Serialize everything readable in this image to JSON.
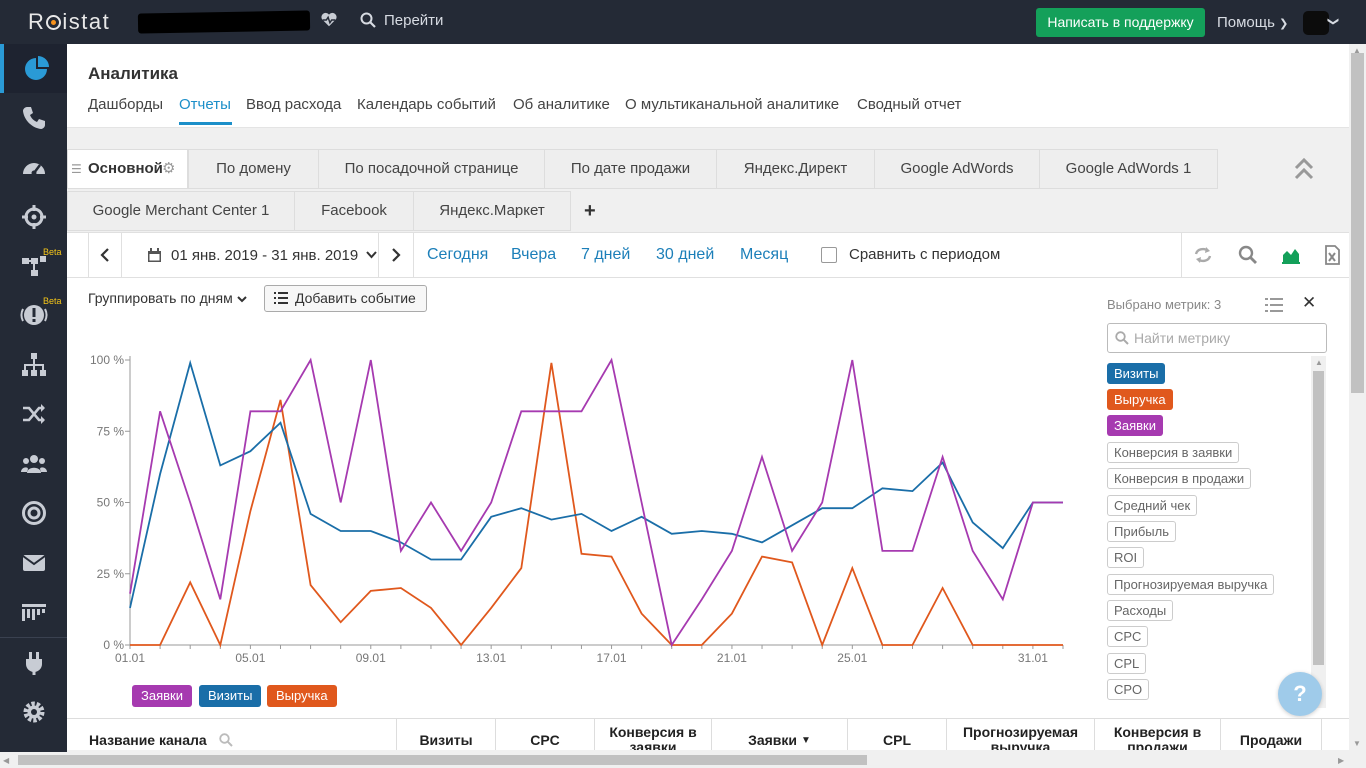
{
  "app": {
    "logo": "Roistat",
    "go_label": "Перейти",
    "support_button": "Написать в поддержку",
    "help_menu": "Помощь"
  },
  "header": {
    "title": "Аналитика",
    "nav": [
      "Дашборды",
      "Отчеты",
      "Ввод расхода",
      "Календарь событий",
      "Об аналитике",
      "О мультиканальной аналитике",
      "Сводный отчет"
    ],
    "active_nav": "Отчеты"
  },
  "report_tabs": {
    "row1": [
      "Основной",
      "По домену",
      "По посадочной странице",
      "По дате продажи",
      "Яндекс.Директ",
      "Google AdWords",
      "Google AdWords 1"
    ],
    "row2": [
      "Google Merchant Center 1",
      "Facebook",
      "Яндекс.Маркет"
    ],
    "add": "+",
    "active": "Основной"
  },
  "datebar": {
    "range": "01 янв. 2019 - 31 янв. 2019",
    "quick": [
      "Сегодня",
      "Вчера",
      "7 дней",
      "30 дней",
      "Месяц"
    ],
    "compare_label": "Сравнить с периодом",
    "compare_checked": false
  },
  "chart_controls": {
    "group_by": "Группировать по дням",
    "add_event": "Добавить событие"
  },
  "metric_panel": {
    "title": "Выбрано метрик: 3",
    "search_placeholder": "Найти метрику",
    "selected": [
      {
        "label": "Визиты",
        "color": "#1a6ea8"
      },
      {
        "label": "Выручка",
        "color": "#e0581d"
      },
      {
        "label": "Заявки",
        "color": "#a63ab0"
      }
    ],
    "available": [
      "Конверсия в заявки",
      "Конверсия в продажи",
      "Средний чек",
      "Прибыль",
      "ROI",
      "Прогнозируемая выручка",
      "Расходы",
      "CPC",
      "CPL",
      "CPO"
    ]
  },
  "chart_data": {
    "type": "line",
    "x": [
      "01.01",
      "02.01",
      "03.01",
      "04.01",
      "05.01",
      "06.01",
      "07.01",
      "08.01",
      "09.01",
      "10.01",
      "11.01",
      "12.01",
      "13.01",
      "14.01",
      "15.01",
      "16.01",
      "17.01",
      "18.01",
      "19.01",
      "20.01",
      "21.01",
      "22.01",
      "23.01",
      "24.01",
      "25.01",
      "26.01",
      "27.01",
      "28.01",
      "29.01",
      "30.01",
      "31.01",
      "01.02"
    ],
    "xticks": [
      "01.01",
      "05.01",
      "09.01",
      "13.01",
      "17.01",
      "21.01",
      "25.01",
      "31.01"
    ],
    "yticks": [
      "0 %",
      "25 %",
      "50 %",
      "75 %",
      "100 %"
    ],
    "ylim": [
      0,
      100
    ],
    "legend": [
      "Заявки",
      "Визиты",
      "Выручка"
    ],
    "series": [
      {
        "name": "Заявки",
        "color": "#a63ab0",
        "values": [
          18,
          82,
          50,
          16,
          82,
          82,
          100,
          50,
          100,
          33,
          50,
          33,
          50,
          82,
          82,
          82,
          100,
          50,
          0,
          16,
          33,
          66,
          33,
          50,
          100,
          33,
          33,
          66,
          33,
          16,
          50,
          50
        ]
      },
      {
        "name": "Визиты",
        "color": "#1a6ea8",
        "values": [
          13,
          60,
          99,
          63,
          68,
          78,
          46,
          40,
          40,
          36,
          30,
          30,
          45,
          48,
          44,
          46,
          40,
          45,
          39,
          40,
          39,
          36,
          42,
          48,
          48,
          55,
          54,
          64,
          43,
          34,
          50,
          50
        ]
      },
      {
        "name": "Выручка",
        "color": "#e0581d",
        "values": [
          0,
          0,
          22,
          0,
          47,
          86,
          21,
          8,
          19,
          20,
          13,
          0,
          13,
          27,
          99,
          32,
          31,
          11,
          0,
          0,
          11,
          31,
          29,
          0,
          27,
          0,
          0,
          20,
          0,
          0,
          0,
          0
        ]
      }
    ]
  },
  "table": {
    "headers": [
      "Название канала",
      "Визиты",
      "CPC",
      "Конверсия в заявки",
      "Заявки",
      "CPL",
      "Прогнозируемая выручка",
      "Конверсия в продажи",
      "Продажи"
    ]
  },
  "help_fab": "?"
}
